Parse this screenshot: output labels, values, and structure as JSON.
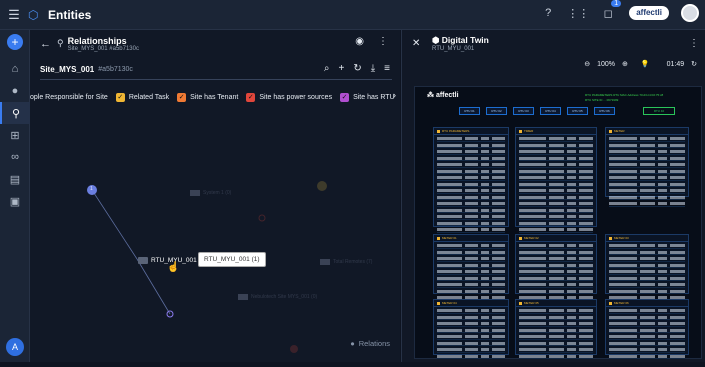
{
  "app": {
    "title": "Entities",
    "notification_count": "1",
    "brand_label": "affectli"
  },
  "topbar": {
    "help_icon": "help-icon",
    "apps_icon": "apps-grid-icon",
    "notif_icon": "notification-icon",
    "avatar_icon": "avatar"
  },
  "nav": {
    "items": [
      "home-icon",
      "chat-icon",
      "relations-icon",
      "hierarchy-icon",
      "link-icon",
      "print-icon",
      "gallery-icon"
    ]
  },
  "relationships": {
    "title": "Relationships",
    "subtitle": "Site_MYS_001 #a5b7130c",
    "site_name": "Site_MYS_001",
    "site_id": "#a5b7130c",
    "filters": [
      {
        "label": "ople Responsible for Site",
        "color": "#f0b634",
        "checked": false
      },
      {
        "label": "Related Task",
        "color": "#f0b634",
        "checked": true
      },
      {
        "label": "Site has Tenant",
        "color": "#f07a34",
        "checked": true
      },
      {
        "label": "Site has power sources",
        "color": "#e0463b",
        "checked": true
      },
      {
        "label": "Site has RTU",
        "color": "#b04fd0",
        "checked": true
      }
    ],
    "graph": {
      "node_label": "RTU_MYU_001 (1)",
      "tooltip": "RTU_MYU_001 (1)",
      "badge": "1",
      "relations_label": "Relations",
      "ghost_labels": [
        "System 1 (0)",
        "Total Remotes (7)",
        "Nebulotech Site MYS_001 (0)"
      ]
    }
  },
  "digital_twin": {
    "title": "Digital Twin",
    "subtitle": "RTU_MYU_001",
    "zoom": "100%",
    "timer": "01:49",
    "logo": "affectli",
    "info_lines": [
      "RTU PARAMETERS  RTU MAC Address  70:d3:c4:b6:75:c8",
      "RTU SITE ID  ...  0671999"
    ],
    "buttons": [
      "RTU 01",
      "RTU 02",
      "RTU 03",
      "RTU 04",
      "RTU 05",
      "RTU 06"
    ],
    "status_button": "RTU 40",
    "panels": [
      "RTU PARAMETERS",
      "TIMER",
      "METER",
      "METER 01",
      "METER 02",
      "METER 03",
      "METER 04",
      "METER 05",
      "METER 06",
      "METER 07",
      "METER 08",
      "METER 09"
    ]
  }
}
